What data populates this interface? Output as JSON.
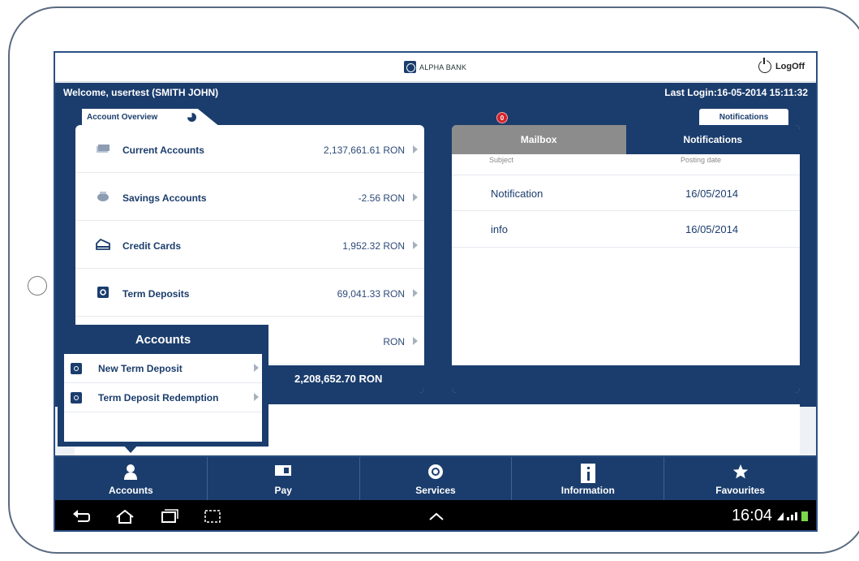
{
  "header": {
    "logo_text": "ALPHA BANK",
    "logoff_label": "LogOff"
  },
  "welcome": {
    "text": "Welcome, usertest (SMITH JOHN)",
    "last_login": "Last Login:16-05-2014 15:11:32"
  },
  "tabs": {
    "account_overview": "Account Overview",
    "notifications": "Notifications",
    "badge": "0"
  },
  "accounts": {
    "items": [
      {
        "label": "Current Accounts",
        "value": "2,137,661.61 RON",
        "icon": "cards-icon"
      },
      {
        "label": "Savings Accounts",
        "value": "-2.56 RON",
        "icon": "piggy-icon"
      },
      {
        "label": "Credit Cards",
        "value": "1,952.32 RON",
        "icon": "credit-card-icon"
      },
      {
        "label": "Term Deposits",
        "value": "69,041.33 RON",
        "icon": "deposit-icon"
      },
      {
        "label": "",
        "value": "RON",
        "icon": ""
      }
    ],
    "total": "2,208,652.70 RON"
  },
  "mailbox": {
    "tab_mailbox": "Mailbox",
    "tab_notifications": "Notifications",
    "col_subject": "Subject",
    "col_date": "Posting date",
    "rows": [
      {
        "subject": "Notification",
        "date": "16/05/2014"
      },
      {
        "subject": "info",
        "date": "16/05/2014"
      }
    ]
  },
  "popup": {
    "title": "Accounts",
    "items": [
      {
        "label": "New Term Deposit"
      },
      {
        "label": "Term Deposit Redemption"
      }
    ]
  },
  "nav": [
    {
      "label": "Accounts",
      "icon": "person-icon"
    },
    {
      "label": "Pay",
      "icon": "pay-icon"
    },
    {
      "label": "Services",
      "icon": "services-icon"
    },
    {
      "label": "Information",
      "icon": "info-icon"
    },
    {
      "label": "Favourites",
      "icon": "star-icon"
    }
  ],
  "android": {
    "clock": "16:04"
  },
  "colors": {
    "primary": "#1b3d6d",
    "badge": "#d3242b",
    "inactive_tab": "#8c8c8c"
  }
}
